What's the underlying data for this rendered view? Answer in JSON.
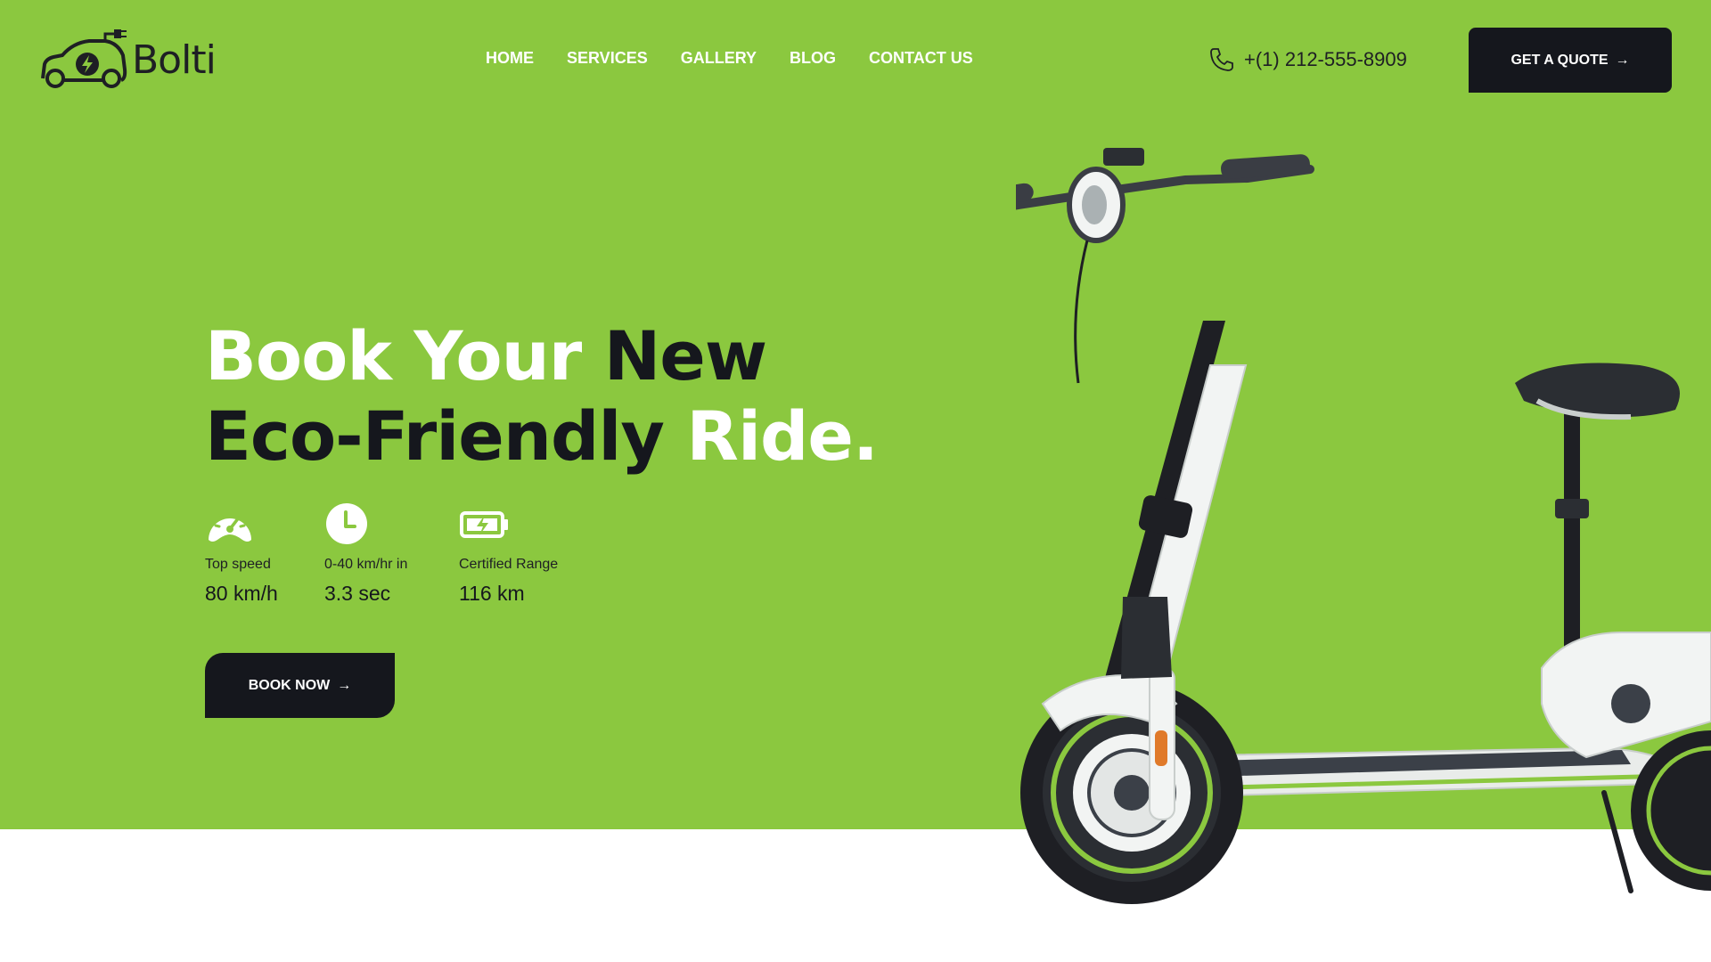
{
  "brand": {
    "name": "Bolti"
  },
  "nav": {
    "items": [
      {
        "label": "HOME"
      },
      {
        "label": "SERVICES"
      },
      {
        "label": "GALLERY"
      },
      {
        "label": "BLOG"
      },
      {
        "label": "CONTACT US"
      }
    ]
  },
  "header": {
    "phone": "+(1) 212-555-8909",
    "quote_label": "GET A QUOTE",
    "icons": {
      "phone": "phone-icon",
      "arrow": "arrow-right-icon"
    }
  },
  "hero": {
    "headline_line1_white": "Book Your",
    "headline_line1_dark": "New",
    "headline_line2_dark": "Eco-Friendly",
    "headline_line2_white": "Ride.",
    "stats": [
      {
        "icon": "speedometer-icon",
        "label": "Top speed",
        "value": "80 km/h"
      },
      {
        "icon": "clock-icon",
        "label": "0-40 km/hr in",
        "value": "3.3 sec"
      },
      {
        "icon": "battery-charging-icon",
        "label": "Certified Range",
        "value": "116 km"
      }
    ],
    "book_label": "BOOK NOW"
  },
  "colors": {
    "hero_bg": "#8bc83f",
    "dark": "#15171d",
    "white": "#ffffff"
  }
}
